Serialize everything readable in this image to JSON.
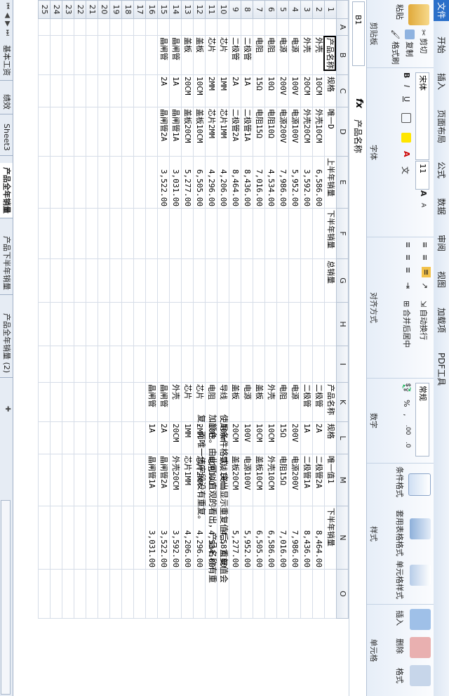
{
  "tabs": [
    "文件",
    "开始",
    "插入",
    "页面布局",
    "公式",
    "数据",
    "审阅",
    "视图",
    "加载项",
    "PDF工具"
  ],
  "clipboard": {
    "paste": "粘贴",
    "cut": "剪切",
    "copy": "复制",
    "painter": "格式刷",
    "label": "剪贴板"
  },
  "font": {
    "name": "宋体",
    "size": "11",
    "bold": "B",
    "italic": "I",
    "underline": "U",
    "label": "字体",
    "grow": "A",
    "shrink": "A",
    "wen": "文"
  },
  "align": {
    "wrap": "自动换行",
    "merge": "合并后居中",
    "label": "对齐方式"
  },
  "number": {
    "format": "常规",
    "percent": "%",
    "comma": ",",
    "label": "数字"
  },
  "styles": {
    "conditional": "条件格式",
    "table": "套用表格格式",
    "cell": "单元格样式",
    "label": "样式"
  },
  "cells": {
    "insert": "插入",
    "delete": "删除",
    "format": "格式",
    "label": "单元格"
  },
  "namebox": "B1",
  "fx": "fx",
  "formula": "产品名称",
  "columns": [
    "A",
    "B",
    "C",
    "D",
    "E",
    "F",
    "G",
    "H",
    "I",
    "K",
    "L",
    "M",
    "N",
    "O"
  ],
  "rows": [
    {
      "n": "1",
      "b": "产品名称",
      "c": "规格",
      "d": "唯一D",
      "e": "上半年销量",
      "f": "下半年销量",
      "g": "总销量",
      "k": "产品名称",
      "l": "规格",
      "m": "唯一值1",
      "nn": "下半年销量"
    },
    {
      "n": "2",
      "b": "外壳",
      "c": "10CM",
      "d": "外壳10CM",
      "e": "6,586.00",
      "k": "二极管",
      "l": "2A",
      "m": "二极管2A",
      "nn": "8,464.00"
    },
    {
      "n": "3",
      "b": "外壳",
      "c": "20CM",
      "d": "外壳20CM",
      "e": "3,592.00",
      "k": "二极管",
      "l": "1A",
      "m": "二极管1A",
      "nn": "8,436.00"
    },
    {
      "n": "4",
      "b": "电源",
      "c": "100V",
      "d": "电源100V",
      "e": "5,952.00",
      "k": "电源",
      "l": "200V",
      "m": "电源200V",
      "nn": "7,986.00"
    },
    {
      "n": "5",
      "b": "电源",
      "c": "200V",
      "d": "电源200V",
      "e": "7,986.00",
      "k": "电阻",
      "l": "15Ω",
      "m": "电阻15Ω",
      "nn": "7,016.00"
    },
    {
      "n": "6",
      "b": "电阻",
      "c": "10Ω",
      "d": "电阻10Ω",
      "e": "4,534.00",
      "k": "外壳",
      "l": "10CM",
      "m": "外壳10CM",
      "nn": "6,586.00"
    },
    {
      "n": "7",
      "b": "电阻",
      "c": "15Ω",
      "d": "电阻15Ω",
      "e": "7,016.00",
      "k": "盖板",
      "l": "10CM",
      "m": "盖板10CM",
      "nn": "6,505.00"
    },
    {
      "n": "8",
      "b": "二极管",
      "c": "1A",
      "d": "二极管1A",
      "e": "8,436.00",
      "k": "电源",
      "l": "100V",
      "m": "电源100V",
      "nn": "5,952.00"
    },
    {
      "n": "9",
      "b": "二极管",
      "c": "2A",
      "d": "二极管2A",
      "e": "8,464.00",
      "k": "盖板",
      "l": "20CM",
      "m": "盖板20CM",
      "nn": "5,277.00"
    },
    {
      "n": "10",
      "b": "芯片",
      "c": "1MM",
      "d": "芯片1MM",
      "e": "4,206.00",
      "k": "导线",
      "l": "10mm",
      "m": "导线10mm",
      "nn": "4,587.00"
    },
    {
      "n": "11",
      "b": "芯片",
      "c": "2MM",
      "d": "芯片2MM",
      "e": "4,296.00",
      "k": "电阻",
      "l": "10Ω",
      "m": "电阻10Ω",
      "nn": "4,534.00"
    },
    {
      "n": "12",
      "b": "盖板",
      "c": "10CM",
      "d": "盖板10CM",
      "e": "6,505.00",
      "k": "芯片",
      "l": "2MM",
      "m": "芯片2MM",
      "nn": "4,296.00"
    },
    {
      "n": "13",
      "b": "盖板",
      "c": "20CM",
      "d": "盖板20CM",
      "e": "5,277.00",
      "k": "芯片",
      "l": "1MM",
      "m": "芯片1MM",
      "nn": "4,206.00"
    },
    {
      "n": "14",
      "b": "晶闸管",
      "c": "1A",
      "d": "晶闸管1A",
      "e": "3,031.00",
      "k": "外壳",
      "l": "20CM",
      "m": "外壳20CM",
      "nn": "3,592.00"
    },
    {
      "n": "15",
      "b": "晶闸管",
      "c": "2A",
      "d": "晶闸管2A",
      "e": "3,522.00",
      "k": "晶闸管",
      "l": "2A",
      "m": "晶闸管2A",
      "nn": "3,522.00"
    },
    {
      "n": "16",
      "k": "晶闸管",
      "l": "1A",
      "m": "晶闸管1A",
      "nn": "3,031.00"
    },
    {
      "n": "17"
    },
    {
      "n": "18"
    },
    {
      "n": "19"
    },
    {
      "n": "20"
    },
    {
      "n": "21"
    },
    {
      "n": "22"
    },
    {
      "n": "23"
    },
    {
      "n": "24"
    },
    {
      "n": "25"
    }
  ],
  "note": "使用条件格式，突出显示重复值后，重复值会加颜色。由此可以直观的看出，产品名称有重复，而唯一值字段没有重复。",
  "sheets": [
    "基本工资",
    "绩效",
    "Sheet3",
    "产品全年销量",
    "产品下半年销量",
    "产品全年销量 (2)"
  ],
  "active_sheet_index": 3,
  "colors": {
    "file_tab": "#2a6fc9",
    "accent": "#f3c24a"
  }
}
